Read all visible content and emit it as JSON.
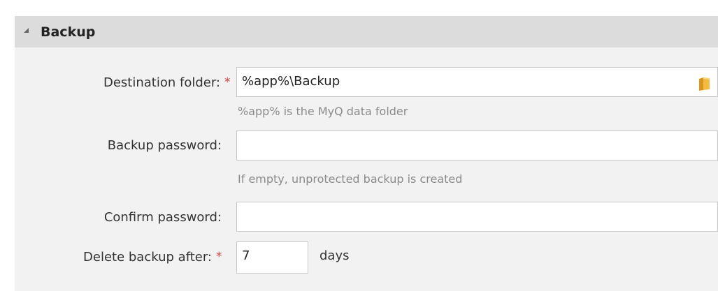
{
  "section": {
    "title": "Backup",
    "collapse_icon": "triangle-collapse-icon"
  },
  "fields": {
    "destination": {
      "label": "Destination folder:",
      "required_mark": "*",
      "value": "%app%\\Backup",
      "hint": "%app% is the MyQ data folder",
      "browse_icon": "folder-icon"
    },
    "password": {
      "label": "Backup password:",
      "value": "",
      "hint": "If empty, unprotected backup is created"
    },
    "confirm": {
      "label": "Confirm password:",
      "value": ""
    },
    "delete_after": {
      "label": "Delete backup after:",
      "required_mark": "*",
      "value": "7",
      "units": "days"
    }
  },
  "colors": {
    "panel_bg": "#f2f2f2",
    "header_bg": "#dcdcdc",
    "required": "#e04040",
    "hint": "#8a8a8a",
    "folder": "#f2b233"
  }
}
